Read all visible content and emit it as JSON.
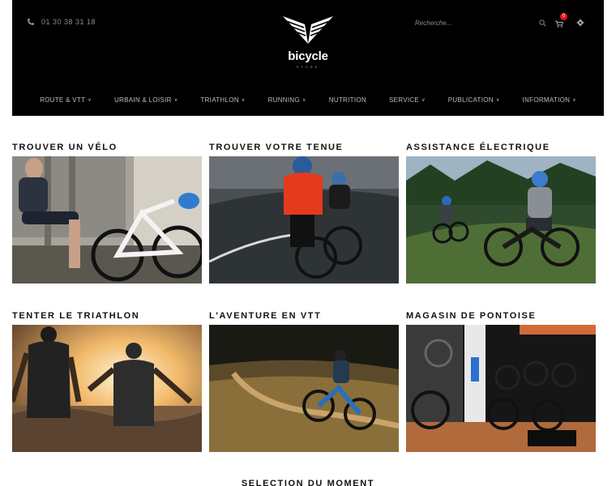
{
  "header": {
    "phone": "01 30 38 31 18",
    "brand": "bicycle",
    "brand_sub": "STORE",
    "search_placeholder": "Recherche...",
    "cart_count": "0"
  },
  "nav": [
    {
      "label": "ROUTE & VTT",
      "dropdown": true
    },
    {
      "label": "URBAIN & LOISIR",
      "dropdown": true
    },
    {
      "label": "TRIATHLON",
      "dropdown": true
    },
    {
      "label": "RUNNING",
      "dropdown": true
    },
    {
      "label": "NUTRITION",
      "dropdown": false
    },
    {
      "label": "SERVICE",
      "dropdown": true
    },
    {
      "label": "PUBLICATION",
      "dropdown": true
    },
    {
      "label": "INFORMATION",
      "dropdown": true
    }
  ],
  "tiles": [
    {
      "title": "TROUVER UN VÉLO"
    },
    {
      "title": "TROUVER VOTRE TENUE"
    },
    {
      "title": "ASSISTANCE ÉLECTRIQUE"
    },
    {
      "title": "TENTER LE TRIATHLON"
    },
    {
      "title": "L'AVENTURE EN VTT"
    },
    {
      "title": "MAGASIN DE PONTOISE"
    }
  ],
  "section_title": "SELECTION DU MOMENT",
  "colors": {
    "header_bg": "#000000",
    "badge": "#e0161e",
    "nav_text": "#bdbdbd"
  }
}
